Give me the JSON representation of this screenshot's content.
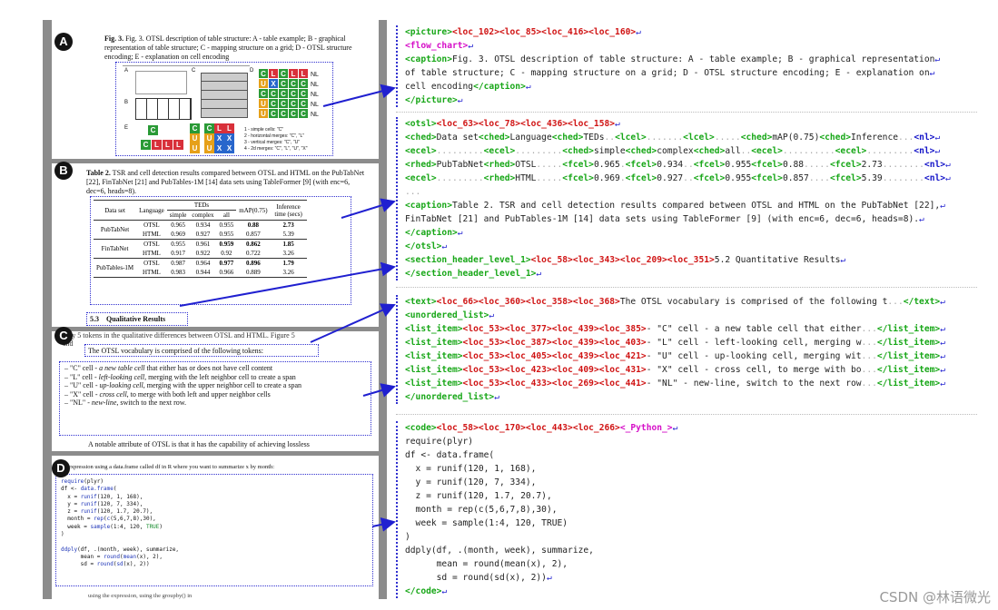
{
  "badges": {
    "a": "A",
    "b": "B",
    "c": "C",
    "d": "D"
  },
  "page_a": {
    "caption": "Fig. 3. OTSL description of table structure: A - table example; B - graphical representation of table structure; C - mapping structure on a grid; D - OTSL structure encoding; E - explanation on cell encoding",
    "panel_labels": [
      "A",
      "B",
      "C",
      "D",
      "E"
    ],
    "nl": "NL",
    "grid_rows": [
      [
        "C",
        "L",
        "C",
        "L",
        "L"
      ],
      [
        "U",
        "X",
        "C",
        "C",
        "C"
      ],
      [
        "C",
        "C",
        "C",
        "C",
        "C"
      ],
      [
        "U",
        "C",
        "C",
        "C",
        "C"
      ],
      [
        "U",
        "C",
        "C",
        "C",
        "C"
      ]
    ],
    "legend": [
      "1 - simple cells: \"C\"",
      "2 - horizontal merges: \"C\", \"L\"",
      "3 - vertical merges: \"C\", \"U\"",
      "4 - 2d merges: \"C\", \"L\", \"U\", \"X\""
    ]
  },
  "page_b": {
    "caption_label": "Table 2.",
    "caption": " TSR and cell detection results compared between OTSL and HTML on the PubTabNet [22], FinTabNet [21] and PubTables-1M [14] data sets using TableFormer [9] (with enc=6, dec=6, heads=8).",
    "head": {
      "dataset": "Data set",
      "language": "Language",
      "teds": "TEDs",
      "simple": "simple",
      "complex": "complex",
      "all": "all",
      "map": "mAP(0.75)",
      "inference": "Inference time (secs)"
    },
    "rows": [
      {
        "dataset": "PubTabNet",
        "lang1": "OTSL",
        "r1": [
          "0.965",
          "0.934",
          "0.955",
          "0.88",
          "2.73"
        ],
        "lang2": "HTML",
        "r2": [
          "0.969",
          "0.927",
          "0.955",
          "0.857",
          "5.39"
        ]
      },
      {
        "dataset": "FinTabNet",
        "lang1": "OTSL",
        "r1": [
          "0.955",
          "0.961",
          "0.959",
          "0.862",
          "1.85"
        ],
        "lang2": "HTML",
        "r2": [
          "0.917",
          "0.922",
          "0.92",
          "0.722",
          "3.26"
        ]
      },
      {
        "dataset": "PubTables-1M",
        "lang1": "OTSL",
        "r1": [
          "0.987",
          "0.964",
          "0.977",
          "0.896",
          "1.79"
        ],
        "lang2": "HTML",
        "r2": [
          "0.983",
          "0.944",
          "0.966",
          "0.889",
          "3.26"
        ]
      }
    ],
    "section": "5.3    Qualitative Results"
  },
  "page_c": {
    "top": "only 5 tokens in the qualitative differences between OTSL and HTML. Figure 5",
    "top2": "and",
    "intro": "The OTSL vocabulary is comprised of the following tokens:",
    "items": [
      {
        "a": "\"C\" cell - ",
        "b": "a new table cell",
        "c": " that either has or does not have cell content"
      },
      {
        "a": "\"L\" cell - ",
        "b": "left-looking cell",
        "c": ", merging with the left neighbor cell to create a span"
      },
      {
        "a": "\"U\" cell - ",
        "b": "up-looking cell",
        "c": ", merging with the upper neighbor cell to create a span"
      },
      {
        "a": "\"X\" cell - ",
        "b": "cross cell",
        "c": ", to merge with both left and upper neighbor cells"
      },
      {
        "a": "\"NL\" - ",
        "b": "new-line",
        "c": ", switch to the next row."
      }
    ],
    "bottom": "A notable attribute of OTSL is that it has the capability of achieving lossless"
  },
  "page_d": {
    "top": "expression using a data.frame called df in R where you want to summarize x by month:",
    "bottom": "using the expression, using the groupby() in"
  },
  "watermark": "CSDN @林语微光"
}
